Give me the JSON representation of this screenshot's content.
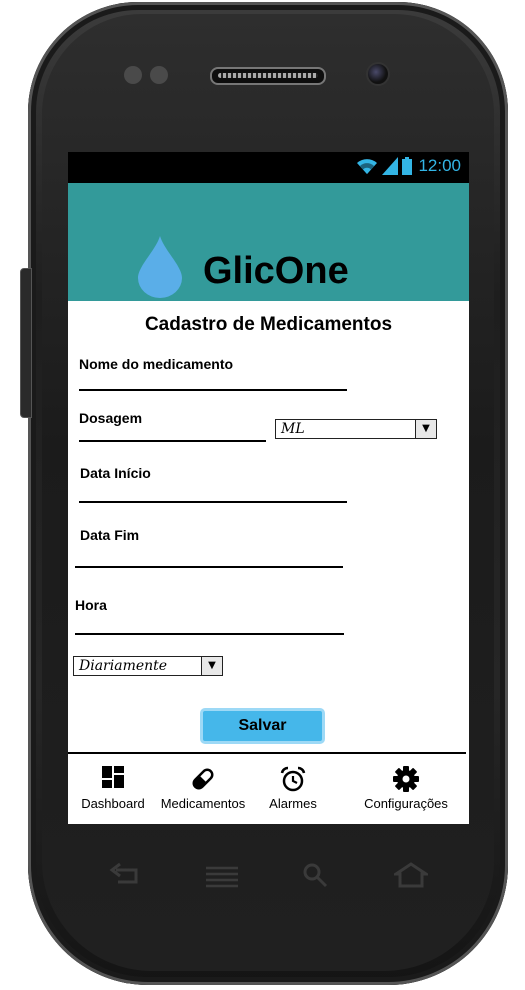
{
  "status": {
    "time": "12:00"
  },
  "header": {
    "app_name": "GlicOne"
  },
  "form": {
    "title": "Cadastro de Medicamentos",
    "name_label": "Nome do medicamento",
    "dosage_label": "Dosagem",
    "unit_select": {
      "value": "ML"
    },
    "start_label": "Data Início",
    "end_label": "Data Fim",
    "time_label": "Hora",
    "frequency_select": {
      "value": "Diariamente"
    },
    "save_label": "Salvar"
  },
  "nav": {
    "items": [
      {
        "label": "Dashboard",
        "icon": "dashboard-icon"
      },
      {
        "label": "Medicamentos",
        "icon": "pill-icon"
      },
      {
        "label": "Alarmes",
        "icon": "alarm-clock-icon"
      },
      {
        "label": "Configurações",
        "icon": "gear-icon"
      }
    ]
  },
  "colors": {
    "header": "#339a9a",
    "drop": "#5aaee8",
    "button": "#45b7ea",
    "status_accent": "#33b5e5"
  }
}
